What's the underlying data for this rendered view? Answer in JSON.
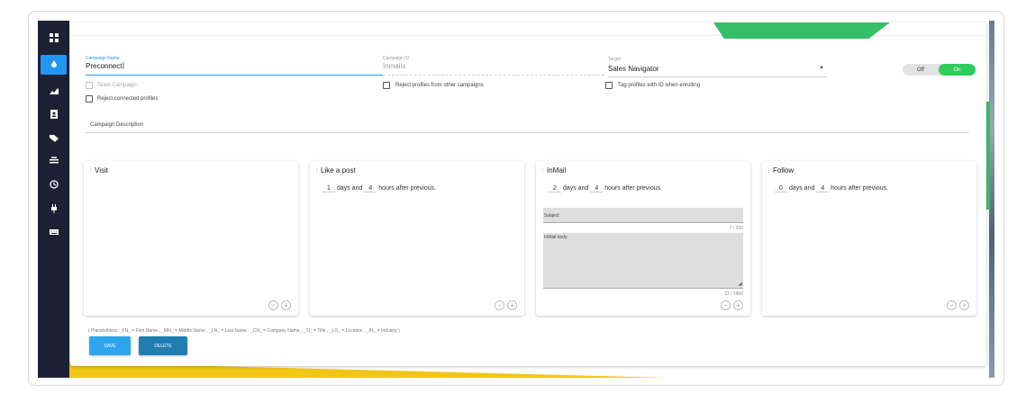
{
  "colors": {
    "accent": "#2196f3",
    "toggle_on": "#2ecc5a",
    "save": "#2da5ec",
    "delete": "#1f7eb1",
    "sidebar": "#1c2134"
  },
  "sidebar": {
    "items": [
      {
        "icon": "dashboard-icon",
        "active": false
      },
      {
        "icon": "drop-icon",
        "active": true
      },
      {
        "icon": "chart-icon",
        "active": false
      },
      {
        "icon": "contacts-icon",
        "active": false
      },
      {
        "icon": "tags-icon",
        "active": false
      },
      {
        "icon": "inbox-icon",
        "active": false
      },
      {
        "icon": "history-icon",
        "active": false
      },
      {
        "icon": "plug-icon",
        "active": false
      },
      {
        "icon": "keyboard-icon",
        "active": false
      }
    ]
  },
  "form": {
    "campaign_name_label": "Campaign Name",
    "campaign_name_value": "Preconnect",
    "campaign_id_label": "Campaign ID",
    "campaign_id_value": "Inmails",
    "target_label": "Target",
    "target_value": "Sales Navigator",
    "toggle_off": "Off",
    "toggle_on": "On",
    "team_campaign": "Team Campaign",
    "reject_other": "Reject profiles from other campaigns",
    "tag_profiles": "Tag profiles with ID when enrolling",
    "reject_connected": "Reject connected profiles",
    "description_label": "Campaign Description"
  },
  "cards": [
    {
      "title": "Visit"
    },
    {
      "title": "Like a post",
      "days": "1",
      "days_text": "days and",
      "hours": "4",
      "hours_text": "hours after previous."
    },
    {
      "title": "InMail",
      "days": "2",
      "days_text": "days and",
      "hours": "4",
      "hours_text": "hours after previous.",
      "subject_placeholder": "Subject",
      "subject_count": "7 / 200",
      "body_placeholder": "InMail body",
      "body_count": "11 / 1900"
    },
    {
      "title": "Follow",
      "days": "0",
      "days_text": "days and",
      "hours": "4",
      "hours_text": "hours after previous."
    }
  ],
  "placeholders_text": "( Placeholders: _FN_ = First Name , _MN_ = Middle Name , _LN_ = Last Name , _CN_ = Company Name , _TI_ = Title , _LO_ = Location , _IN_ = Industry )",
  "buttons": {
    "save": "SAVE",
    "delete": "DELETE"
  }
}
